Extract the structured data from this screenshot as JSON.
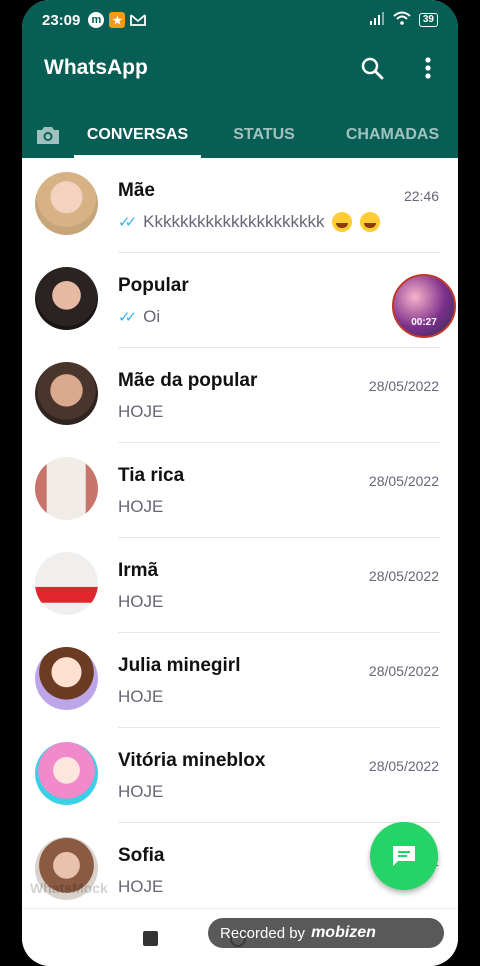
{
  "status_bar": {
    "time": "23:09",
    "battery": "39"
  },
  "app": {
    "title": "WhatsApp",
    "accent": "#075e54",
    "fab_color": "#25d366"
  },
  "tabs": [
    {
      "label": "CONVERSAS",
      "active": true
    },
    {
      "label": "STATUS",
      "active": false
    },
    {
      "label": "CHAMADAS",
      "active": false
    }
  ],
  "chats": [
    {
      "name": "Mãe",
      "time": "22:46",
      "preview": "Kkkkkkkkkkkkkkkkkkkkk",
      "read": true,
      "emoji": true
    },
    {
      "name": "Popular",
      "time": "",
      "preview": "Oi",
      "read": true,
      "emoji": false
    },
    {
      "name": "Mãe da popular",
      "time": "28/05/2022",
      "preview": "HOJE",
      "read": false,
      "emoji": false
    },
    {
      "name": "Tia rica",
      "time": "28/05/2022",
      "preview": "HOJE",
      "read": false,
      "emoji": false
    },
    {
      "name": "Irmã",
      "time": "28/05/2022",
      "preview": "HOJE",
      "read": false,
      "emoji": false
    },
    {
      "name": "Julia minegirl",
      "time": "28/05/2022",
      "preview": "HOJE",
      "read": false,
      "emoji": false
    },
    {
      "name": "Vitória mineblox",
      "time": "28/05/2022",
      "preview": "HOJE",
      "read": false,
      "emoji": false
    },
    {
      "name": "Sofia",
      "time": "2",
      "preview": "HOJE",
      "read": false,
      "emoji": false
    }
  ],
  "video_bubble": {
    "duration": "00:27"
  },
  "overlay": {
    "watermark": "WhatsMock",
    "recorder_prefix": "Recorded by",
    "recorder_brand": "mobizen"
  }
}
